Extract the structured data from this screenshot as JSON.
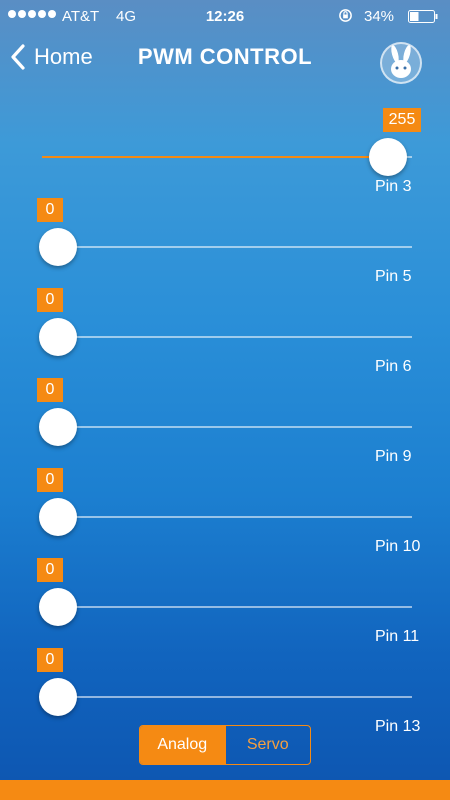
{
  "status_bar": {
    "carrier": "AT&T",
    "network": "4G",
    "time": "12:26",
    "battery": "34%"
  },
  "nav": {
    "back_label": "Home",
    "title": "PWM CONTROL",
    "avatar_icon": "bunny-icon"
  },
  "sliders": [
    {
      "pin": "Pin 3",
      "value": "255",
      "max": 255
    },
    {
      "pin": "Pin 5",
      "value": "0",
      "max": 255
    },
    {
      "pin": "Pin 6",
      "value": "0",
      "max": 255
    },
    {
      "pin": "Pin 9",
      "value": "0",
      "max": 255
    },
    {
      "pin": "Pin 10",
      "value": "0",
      "max": 255
    },
    {
      "pin": "Pin 11",
      "value": "0",
      "max": 255
    },
    {
      "pin": "Pin 13",
      "value": "0",
      "max": 255
    }
  ],
  "mode": {
    "options": [
      "Analog",
      "Servo"
    ],
    "selected": "Analog"
  },
  "colors": {
    "accent": "#f58a13"
  }
}
